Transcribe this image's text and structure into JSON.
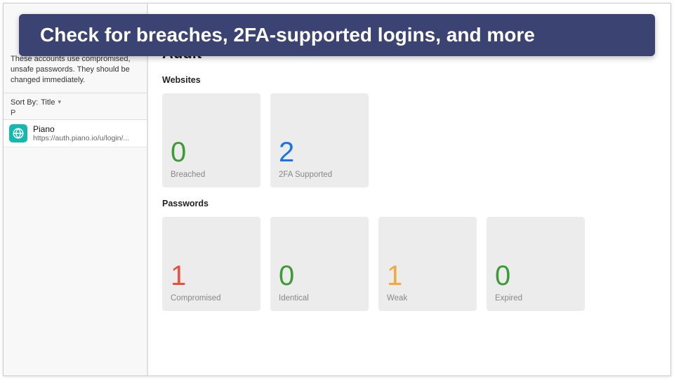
{
  "banner": {
    "text": "Check for breaches, 2FA-supported logins, and more"
  },
  "sidebar": {
    "description": "These accounts use compromised, unsafe passwords. They should be changed immediately.",
    "sort_prefix": "Sort By:",
    "sort_value": "Title",
    "group_letter": "P",
    "items": [
      {
        "title": "Piano",
        "subtitle": "https://auth.piano.io/u/login/..."
      }
    ]
  },
  "main": {
    "title": "Audit",
    "sections": {
      "websites": {
        "label": "Websites",
        "tiles": [
          {
            "value": "0",
            "label": "Breached",
            "color": "c-green"
          },
          {
            "value": "2",
            "label": "2FA Supported",
            "color": "c-blue"
          }
        ]
      },
      "passwords": {
        "label": "Passwords",
        "tiles": [
          {
            "value": "1",
            "label": "Compromised",
            "color": "c-red"
          },
          {
            "value": "0",
            "label": "Identical",
            "color": "c-green"
          },
          {
            "value": "1",
            "label": "Weak",
            "color": "c-orange"
          },
          {
            "value": "0",
            "label": "Expired",
            "color": "c-green"
          }
        ]
      }
    }
  }
}
